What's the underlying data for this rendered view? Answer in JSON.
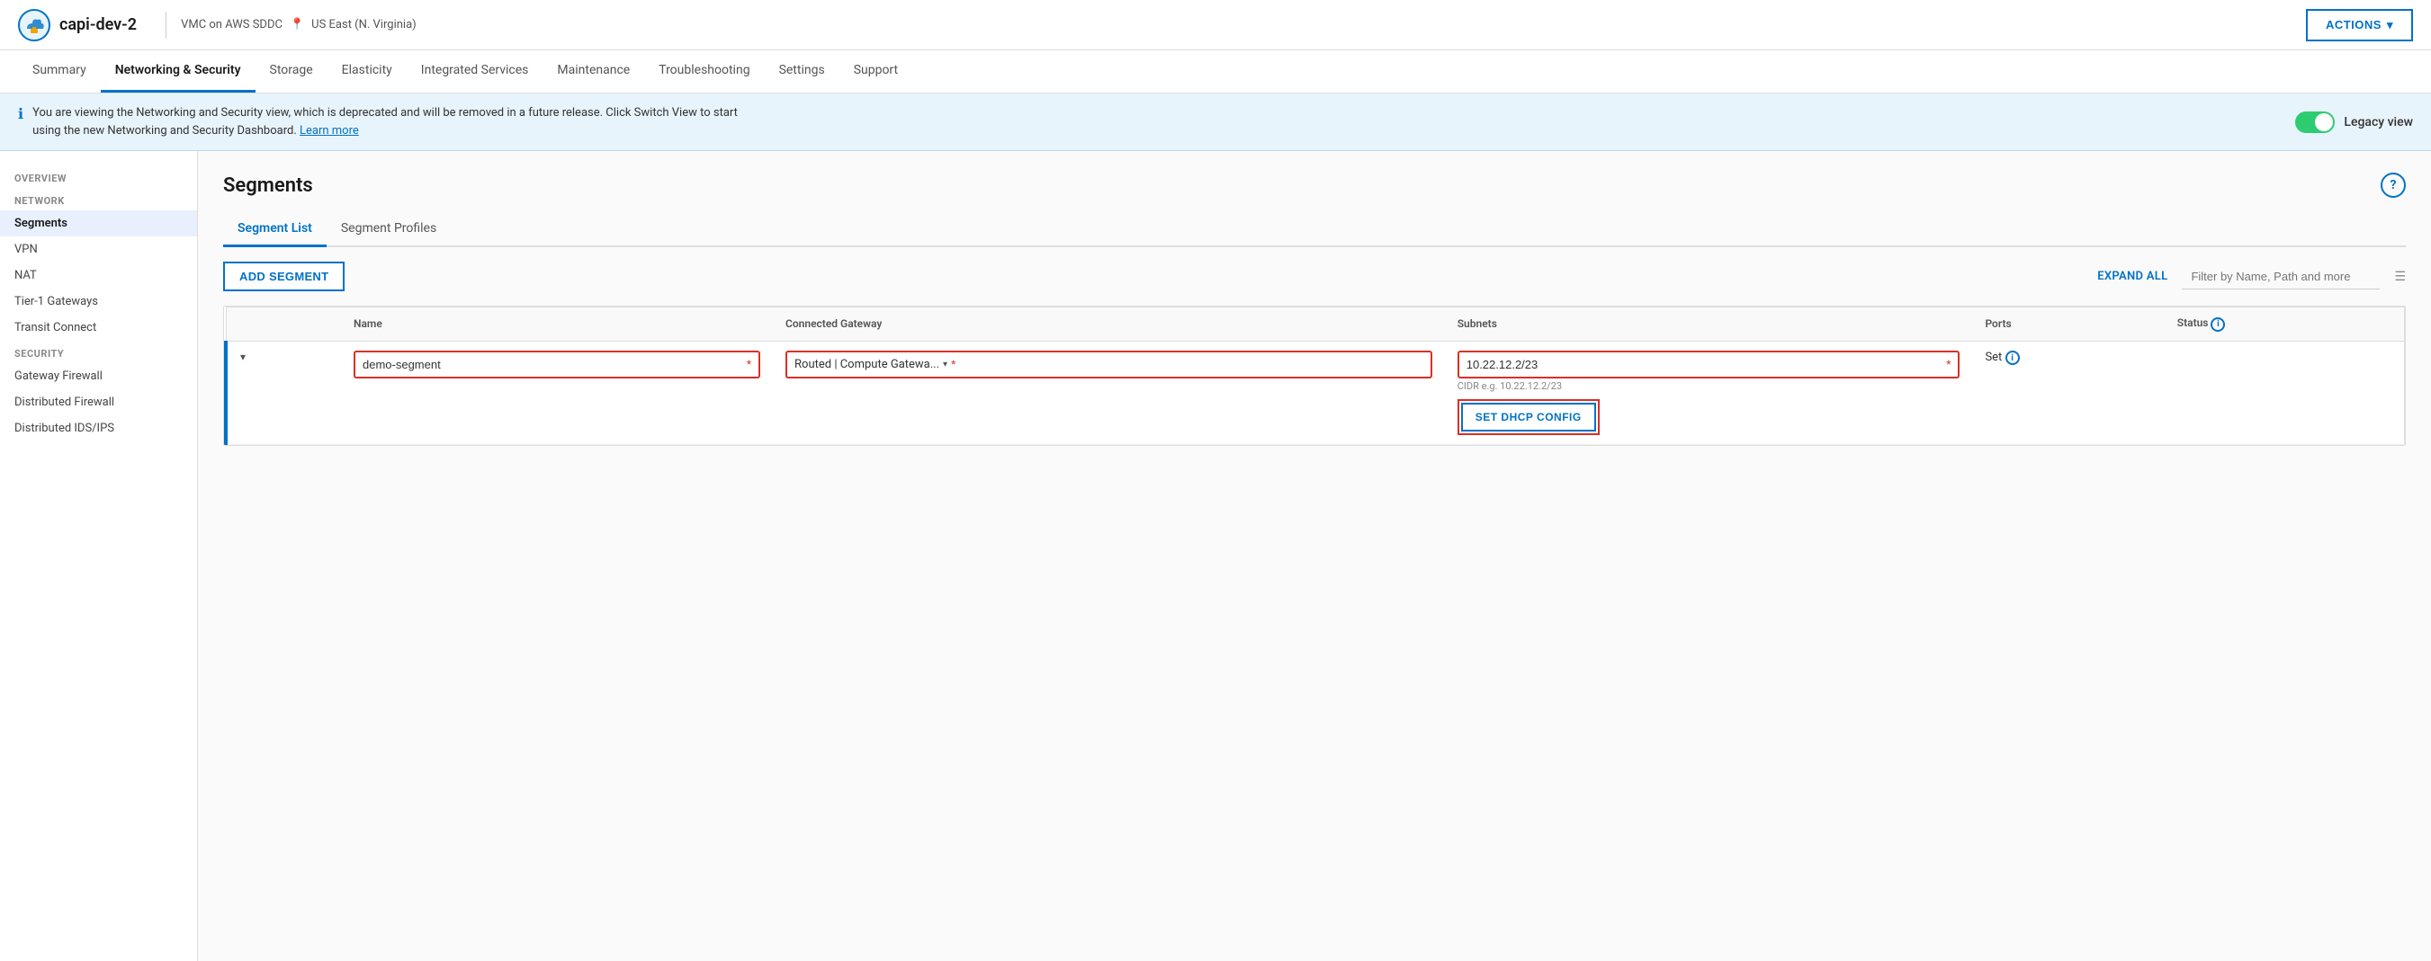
{
  "header": {
    "app_name": "capi-dev-2",
    "sddc_type": "VMC on AWS SDDC",
    "location": "US East (N. Virginia)",
    "actions_label": "ACTIONS"
  },
  "nav": {
    "tabs": [
      {
        "id": "summary",
        "label": "Summary",
        "active": false
      },
      {
        "id": "networking-security",
        "label": "Networking & Security",
        "active": true
      },
      {
        "id": "storage",
        "label": "Storage",
        "active": false
      },
      {
        "id": "elasticity",
        "label": "Elasticity",
        "active": false
      },
      {
        "id": "integrated-services",
        "label": "Integrated Services",
        "active": false
      },
      {
        "id": "maintenance",
        "label": "Maintenance",
        "active": false
      },
      {
        "id": "troubleshooting",
        "label": "Troubleshooting",
        "active": false
      },
      {
        "id": "settings",
        "label": "Settings",
        "active": false
      },
      {
        "id": "support",
        "label": "Support",
        "active": false
      }
    ]
  },
  "banner": {
    "message_line1": "You are viewing the Networking and Security view, which is deprecated and will be removed in a future release. Click Switch View to start",
    "message_line2": "using the new Networking and Security Dashboard.",
    "learn_more": "Learn more",
    "legacy_label": "Legacy view",
    "toggle_on": true
  },
  "sidebar": {
    "sections": [
      {
        "title": "Overview",
        "items": []
      },
      {
        "title": "Network",
        "items": [
          {
            "id": "segments",
            "label": "Segments",
            "active": true
          },
          {
            "id": "vpn",
            "label": "VPN",
            "active": false
          },
          {
            "id": "nat",
            "label": "NAT",
            "active": false
          },
          {
            "id": "tier1-gateways",
            "label": "Tier-1 Gateways",
            "active": false
          },
          {
            "id": "transit-connect",
            "label": "Transit Connect",
            "active": false
          }
        ]
      },
      {
        "title": "Security",
        "items": [
          {
            "id": "gateway-firewall",
            "label": "Gateway Firewall",
            "active": false
          },
          {
            "id": "distributed-firewall",
            "label": "Distributed Firewall",
            "active": false
          },
          {
            "id": "distributed-ids-ips",
            "label": "Distributed IDS/IPS",
            "active": false
          }
        ]
      }
    ]
  },
  "content": {
    "page_title": "Segments",
    "sub_tabs": [
      {
        "id": "segment-list",
        "label": "Segment List",
        "active": true
      },
      {
        "id": "segment-profiles",
        "label": "Segment Profiles",
        "active": false
      }
    ],
    "toolbar": {
      "add_label": "ADD SEGMENT",
      "expand_label": "EXPAND ALL",
      "filter_placeholder": "Filter by Name, Path and more"
    },
    "table": {
      "columns": [
        {
          "id": "expand",
          "label": ""
        },
        {
          "id": "name",
          "label": "Name"
        },
        {
          "id": "connected-gateway",
          "label": "Connected Gateway"
        },
        {
          "id": "subnets",
          "label": "Subnets"
        },
        {
          "id": "ports",
          "label": "Ports"
        },
        {
          "id": "status",
          "label": "Status"
        }
      ],
      "rows": [
        {
          "id": "demo-segment-row",
          "expanded": true,
          "name": "demo-segment",
          "connected_gateway": "Routed | Compute Gatewa...",
          "subnets": "10.22.12.2/23",
          "subnet_hint": "CIDR e.g. 10.22.12.2/23",
          "ports": "Set",
          "status": "",
          "editing": true,
          "dhcp_button": "SET DHCP CONFIG"
        }
      ]
    }
  }
}
